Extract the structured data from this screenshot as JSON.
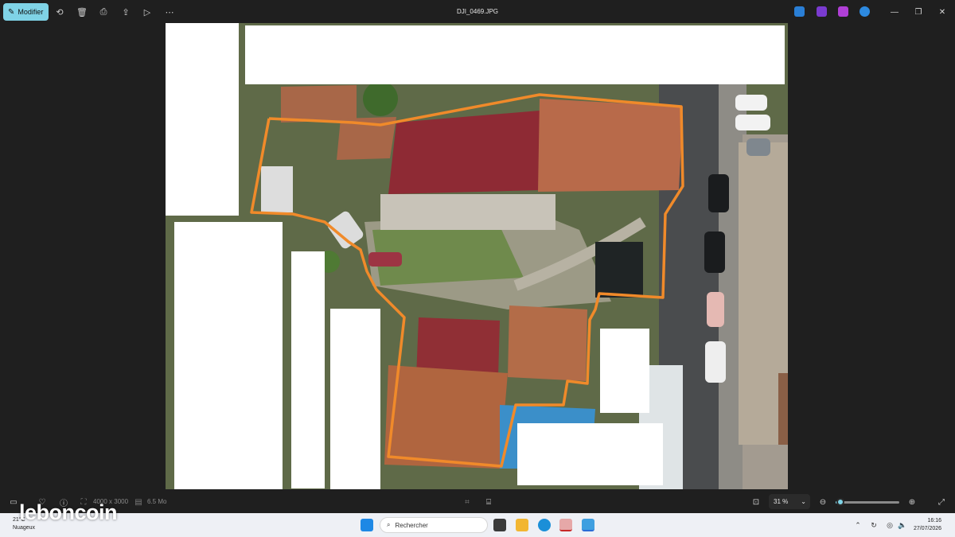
{
  "toolbar": {
    "edit_label": "Modifier",
    "icons": [
      "edit-icon",
      "rotate-icon",
      "delete-icon",
      "print-icon",
      "share-icon",
      "slideshow-icon",
      "more-icon"
    ]
  },
  "window": {
    "title": "DJI_0469.JPG",
    "app_icons": [
      "photos-app-icon",
      "designer-app-icon",
      "clipchamp-app-icon",
      "onedrive-icon"
    ],
    "controls": [
      "minimize-icon",
      "restore-icon",
      "close-icon"
    ]
  },
  "statusbar": {
    "dimensions": "4000 x 3000",
    "file_size": "6.5 Mo",
    "zoom": "31 %",
    "zoom_fraction": 0.08
  },
  "taskbar": {
    "weather_temp": "21°C",
    "weather_desc": "Nuageux",
    "watermark": "leboncoin",
    "search_placeholder": "Rechercher",
    "time": "16:16",
    "date": "27/07/2026"
  },
  "colors": {
    "accent": "#7fd3e6",
    "boundary": "#f08a2a",
    "roof_red": "#8e2a34",
    "roof_tile": "#b86a4a"
  }
}
